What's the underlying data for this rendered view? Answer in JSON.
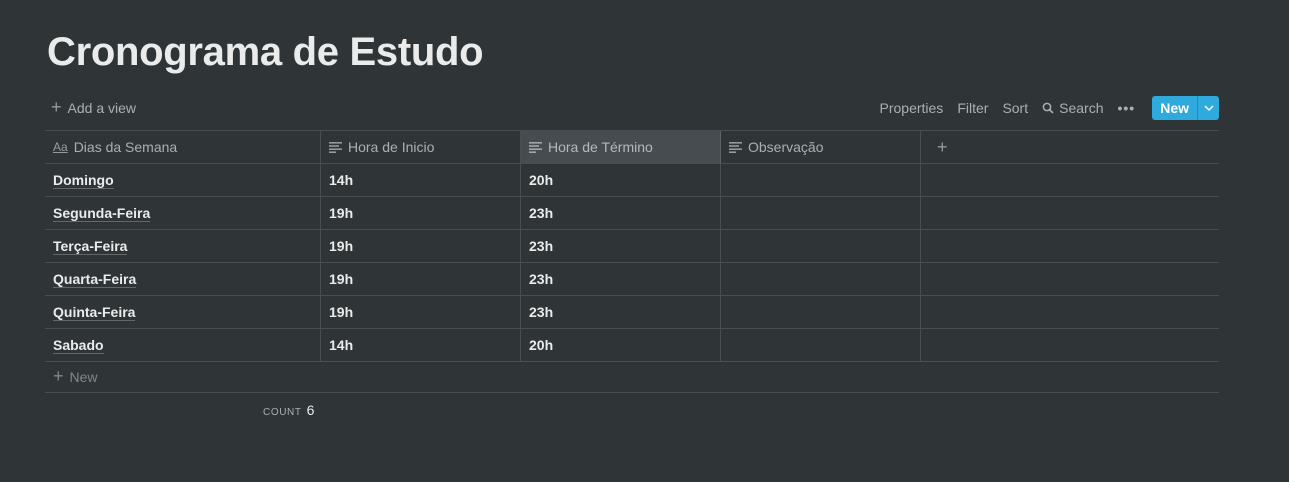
{
  "page": {
    "title": "Cronograma de Estudo"
  },
  "toolbar": {
    "add_view": "Add a view",
    "properties": "Properties",
    "filter": "Filter",
    "sort": "Sort",
    "search": "Search",
    "more": "•••",
    "new": "New"
  },
  "table": {
    "headers": [
      "Dias da Semana",
      "Hora de Inicio",
      "Hora de Término",
      "Observação"
    ],
    "title_icon": "Aa",
    "rows": [
      [
        "Domingo",
        "14h",
        "20h",
        ""
      ],
      [
        "Segunda-Feira",
        "19h",
        "23h",
        ""
      ],
      [
        "Terça-Feira",
        "19h",
        "23h",
        ""
      ],
      [
        "Quarta-Feira",
        "19h",
        "23h",
        ""
      ],
      [
        "Quinta-Feira",
        "19h",
        "23h",
        ""
      ],
      [
        "Sabado",
        "14h",
        "20h",
        ""
      ]
    ],
    "new_row": "New",
    "count_label": "COUNT",
    "count_value": "6"
  },
  "colors": {
    "background": "#2f3437",
    "accent": "#2eaadc",
    "active_header": "#474c50"
  }
}
